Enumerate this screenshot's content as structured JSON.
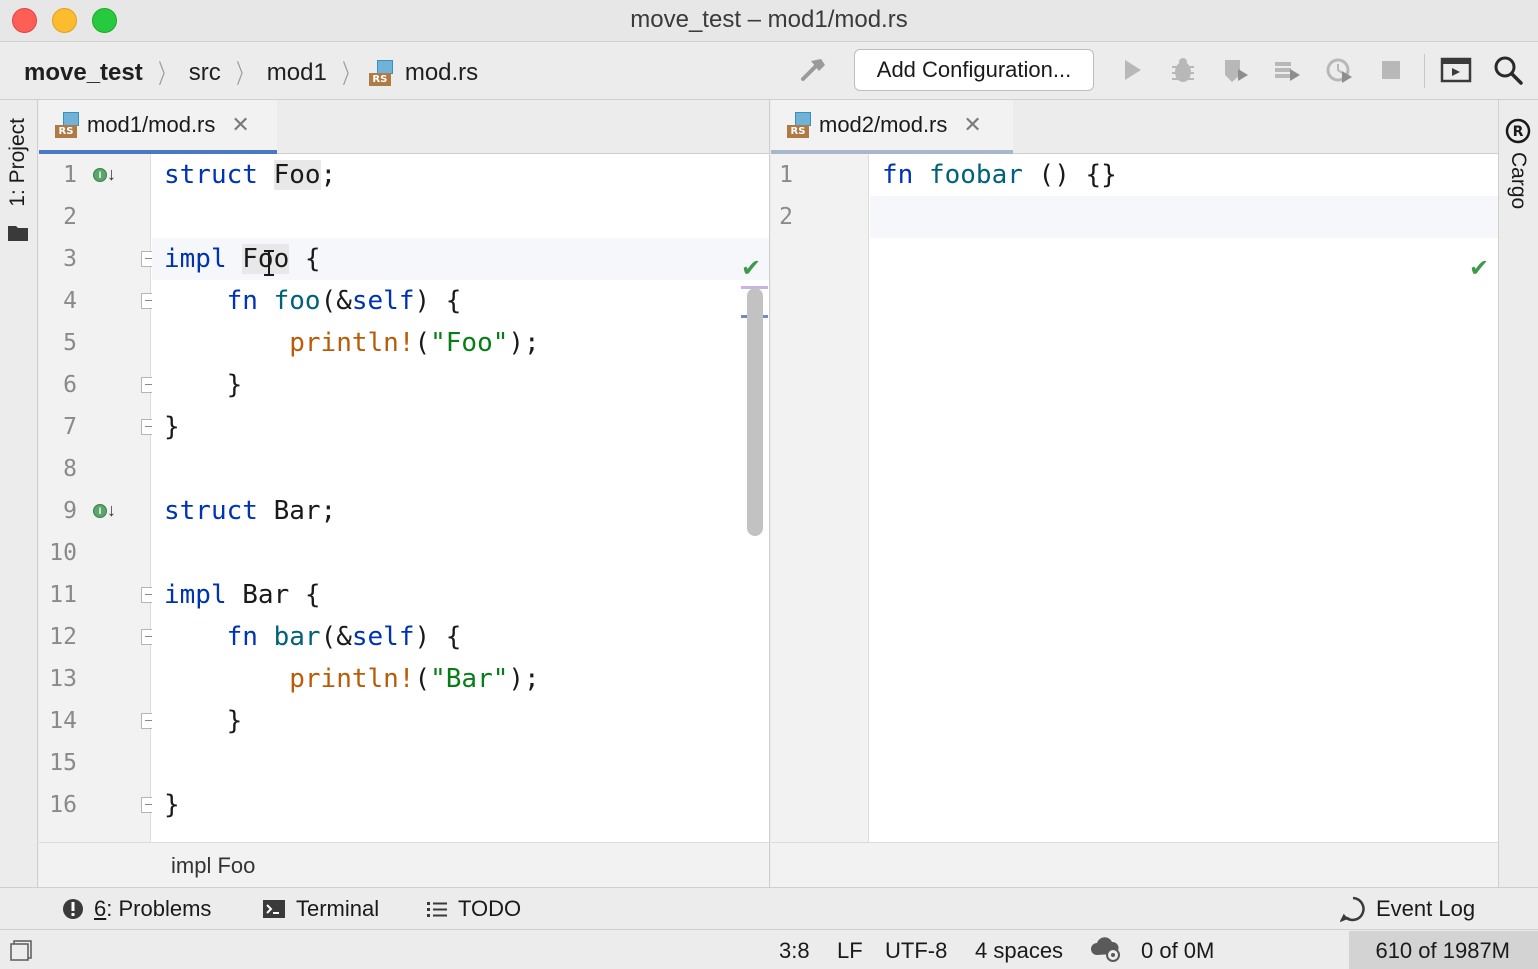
{
  "window": {
    "title": "move_test – mod1/mod.rs"
  },
  "breadcrumbs": [
    "move_test",
    "src",
    "mod1",
    "mod.rs"
  ],
  "toolbar": {
    "add_configuration": "Add Configuration..."
  },
  "left_strip": {
    "project_label": "1: Project"
  },
  "right_strip": {
    "cargo_label": "Cargo"
  },
  "left_editor": {
    "tab": {
      "label": "mod1/mod.rs"
    },
    "footer_breadcrumb": "impl Foo",
    "line_numbers": [
      "1",
      "2",
      "3",
      "4",
      "5",
      "6",
      "7",
      "8",
      "9",
      "10",
      "11",
      "12",
      "13",
      "14",
      "15",
      "16"
    ]
  },
  "right_editor": {
    "tab": {
      "label": "mod2/mod.rs"
    },
    "line_numbers": [
      "1",
      "2"
    ]
  },
  "code": {
    "struct_kw": "struct",
    "impl_kw": "impl",
    "fn_kw": "fn",
    "foo_type": "Foo",
    "bar_type": "Bar",
    "semicolon": ";",
    "open_brace": " {",
    "close_brace": "}",
    "foo_fn": "foo",
    "bar_fn": "bar",
    "self_param_open": "(&",
    "self_kw": "self",
    "self_param_close": ") {",
    "println": "println!",
    "paren_open": "(",
    "foo_str": "\"Foo\"",
    "bar_str": "\"Bar\"",
    "paren_close": ");",
    "foobar_fn": "foobar",
    "foobar_rest": " () {}"
  },
  "tool_windows": {
    "problems_num": "6",
    "problems_label": ": Problems",
    "terminal": "Terminal",
    "todo": "TODO",
    "event_log": "Event Log"
  },
  "status": {
    "position": "3:8",
    "line_sep": "LF",
    "encoding": "UTF-8",
    "indent": "4 spaces",
    "progress": "0 of 0M",
    "memory": "610 of 1987M"
  },
  "colors": {
    "keyword": "#0033b3",
    "function": "#00627a",
    "macro": "#b85c0a",
    "string": "#067d17",
    "tab_active_underline": "#4a78c2",
    "ok_check": "#3c9a4a"
  },
  "icons": [
    "build-hammer-icon",
    "run-icon",
    "debug-icon",
    "coverage-icon",
    "profile-icon",
    "concurrency-icon",
    "stop-icon",
    "layout-icon",
    "search-icon",
    "warning-icon",
    "terminal-icon",
    "todo-icon",
    "event-log-icon",
    "cargo-icon",
    "folder-icon"
  ]
}
